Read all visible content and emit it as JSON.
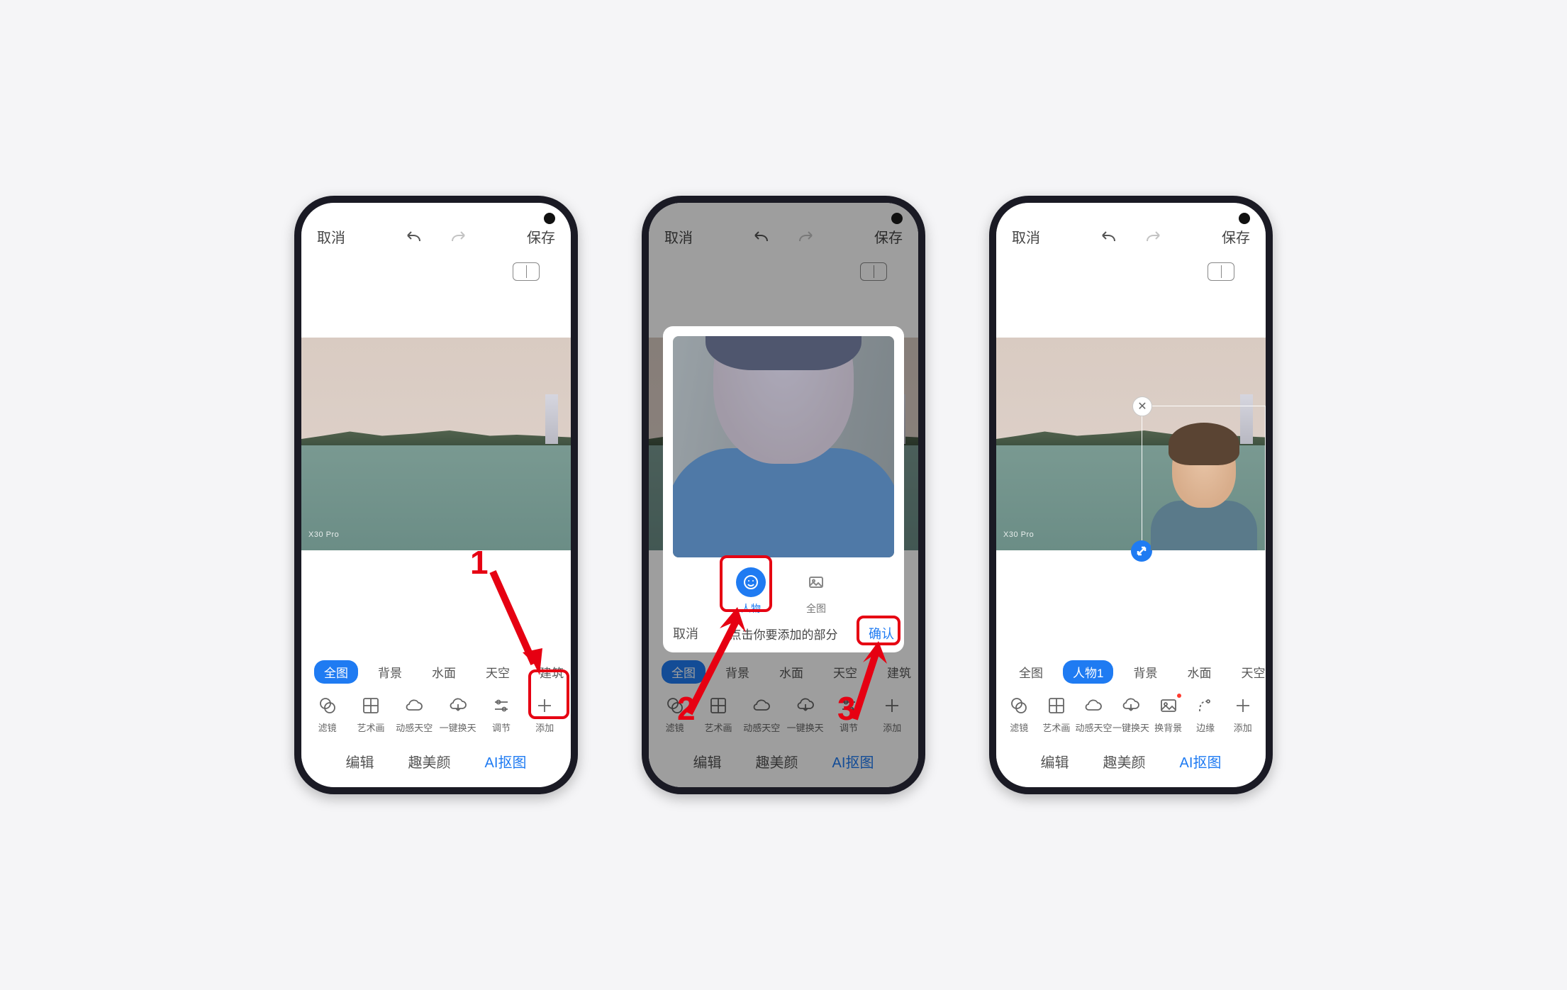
{
  "common": {
    "cancel": "取消",
    "save": "保存",
    "watermark": "X30 Pro",
    "tabs": {
      "edit": "编辑",
      "beauty": "趣美颜",
      "ai": "AI抠图"
    }
  },
  "chips_base": [
    "全图",
    "背景",
    "水面",
    "天空",
    "建筑"
  ],
  "tools_base": {
    "filter": "滤镜",
    "art": "艺术画",
    "sky_dynamic": "动感天空",
    "sky_swap": "一键换天",
    "adjust": "调节",
    "add": "添加",
    "bg_swap": "换背景",
    "edge": "边缘"
  },
  "popup": {
    "person": "人物",
    "full": "全图",
    "cancel": "取消",
    "hint": "点击你要添加的部分",
    "confirm": "确认"
  },
  "chips_phone3": [
    "全图",
    "人物1",
    "背景",
    "水面",
    "天空"
  ],
  "annotations": {
    "step1": "1",
    "step2": "2",
    "step3": "3"
  }
}
